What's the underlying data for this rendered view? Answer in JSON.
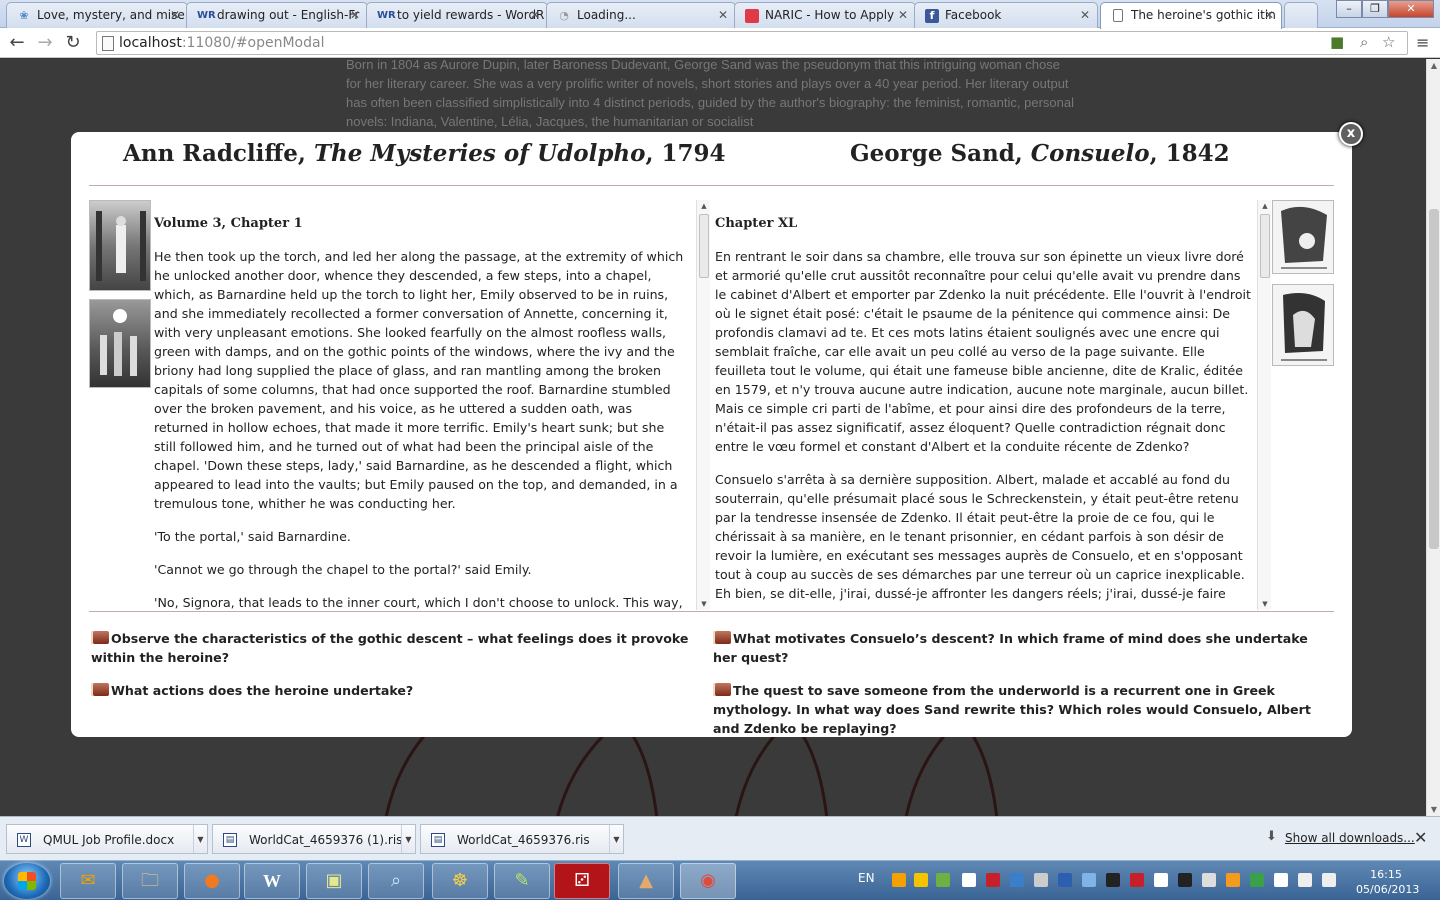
{
  "browser": {
    "tabs": [
      {
        "title": "Love, mystery, and mise",
        "icon": "swirl-icon",
        "color": "#4a86c8"
      },
      {
        "title": "drawing out - English-Fr",
        "icon": "wr-icon",
        "color": "#2b4f9a"
      },
      {
        "title": "to yield rewards - WordR",
        "icon": "wr-icon",
        "color": "#2b4f9a"
      },
      {
        "title": "Loading...",
        "icon": "spinner-icon",
        "color": "#999999"
      },
      {
        "title": "NARIC - How to Apply",
        "icon": "naric-icon",
        "color": "#e03a48"
      },
      {
        "title": "Facebook",
        "icon": "facebook-icon",
        "color": "#3b5998"
      },
      {
        "title": "The heroine's gothic itin",
        "icon": "page-icon",
        "color": "#ffffff"
      }
    ],
    "url_host": "localhost",
    "url_rest": ":11080/#openModal"
  },
  "page": {
    "background_text": "Born in 1804 as Aurore Dupin, later Baroness Dudevant, George Sand was the pseudonym that this intriguing woman chose for her literary career. She was a very prolific writer of novels, short stories and plays over a 40 year period. Her literary output has often been classified simplistically into 4 distinct periods, guided by the author's biography: the feminist, romantic, personal novels: Indiana, Valentine, Lélia, Jacques, the humanitarian or socialist"
  },
  "modal": {
    "close_label": "x",
    "left": {
      "author": "Ann Radcliffe, ",
      "work": "The Mysteries of Udolpho",
      "year": ", 1794",
      "chapter": "Volume 3, Chapter 1",
      "paragraphs": [
        "He then took up the torch, and led her along the passage, at the extremity of which he unlocked another door, whence they descended, a few steps, into a chapel, which, as Barnardine held up the torch to light her, Emily observed to be in ruins, and she immediately recollected a former conversation of Annette, concerning it, with very unpleasant emotions. She looked fearfully on the almost roofless walls, green with damps, and on the gothic points of the windows, where the ivy and the briony had long supplied the place of glass, and ran mantling among the broken capitals of some columns, that had once supported the roof. Barnardine stumbled over the broken pavement, and his voice, as he uttered a sudden oath, was returned in hollow echoes, that made it more terrific. Emily's heart sunk; but she still followed him, and he turned out of what had been the principal aisle of the chapel. 'Down these steps, lady,' said Barnardine, as he descended a flight, which appeared to lead into the vaults; but Emily paused on the top, and demanded, in a tremulous tone, whither he was conducting her.",
        "'To the portal,' said Barnardine.",
        "'Cannot we go through the chapel to the portal?' said Emily.",
        "'No, Signora, that leads to the inner court, which I don't choose to unlock. This way,"
      ],
      "questions": [
        "Observe the characteristics of the gothic descent – what feelings does it provoke within the heroine?",
        "What actions does the heroine undertake?"
      ]
    },
    "right": {
      "author": "George Sand, ",
      "work": "Consuelo",
      "year": ", 1842",
      "chapter": "Chapter XL",
      "paragraphs": [
        "En rentrant le soir dans sa chambre, elle trouva sur son épinette un vieux livre doré et armorié qu'elle crut aussitôt reconnaître pour celui qu'elle avait vu prendre dans le cabinet d'Albert et emporter par Zdenko la nuit précédente. Elle l'ouvrit à l'endroit où le signet était posé: c'était le psaume de la pénitence qui commence ainsi: De profondis clamavi ad te. Et ces mots latins étaient soulignés avec une encre qui semblait fraîche, car elle avait un peu collé au verso de la page suivante. Elle feuilleta tout le volume, qui était une fameuse bible ancienne, dite de Kralic, éditée en 1579, et n'y trouva aucune autre indication, aucune note marginale, aucun billet. Mais ce simple cri parti de l'abîme, et pour ainsi dire des profondeurs de la terre, n'était-il pas assez significatif, assez éloquent? Quelle contradiction régnait donc entre le vœu formel et constant d'Albert et la conduite récente de Zdenko?",
        "Consuelo s'arrêta à sa dernière supposition. Albert, malade et accablé au fond du souterrain, qu'elle présumait placé sous le Schreckenstein, y était peut-être retenu par la tendresse insensée de Zdenko. Il était peut-être la proie de ce fou, qui le chérissait à sa manière, en le tenant prisonnier, en cédant parfois à son désir de revoir la lumière, en exécutant ses messages auprès de Consuelo, et en s'opposant tout à coup au succès de ses démarches par une terreur où un caprice inexplicable. Eh bien, se dit-elle, j'irai, dussé-je affronter les dangers réels; j'irai, dussé-je faire"
      ],
      "questions": [
        "What motivates Consuelo’s descent? In which frame of mind does she undertake her quest?",
        "The quest to save someone from the underworld is a recurrent one in Greek mythology. In what way does Sand rewrite this? Which roles would Consuelo, Albert and Zdenko be replaying?"
      ]
    }
  },
  "downloads": {
    "items": [
      "QMUL Job Profile.docx",
      "WorldCat_4659376 (1).ris",
      "WorldCat_4659376.ris"
    ],
    "show_all": "Show all downloads..."
  },
  "taskbar": {
    "language": "EN",
    "time": "16:15",
    "date": "05/06/2013"
  }
}
